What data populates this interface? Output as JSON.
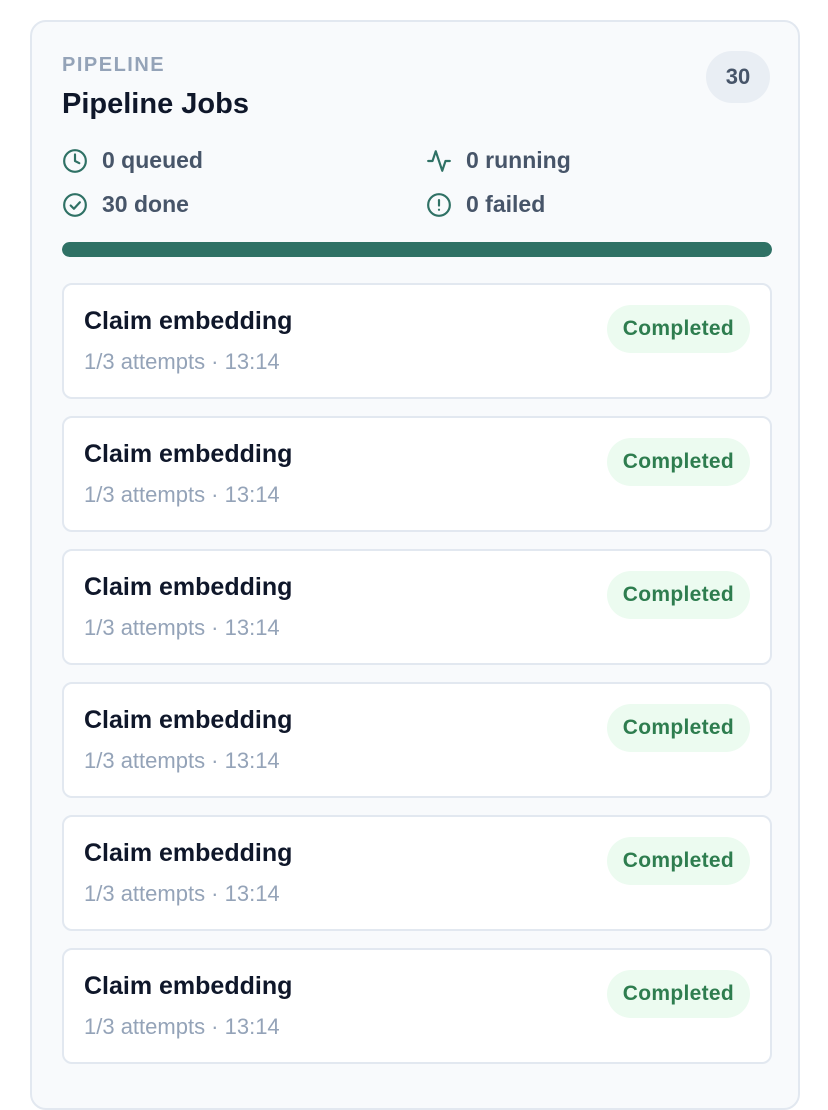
{
  "header": {
    "eyebrow": "PIPELINE",
    "title": "Pipeline Jobs",
    "total_count": "30"
  },
  "stats": {
    "queued": {
      "label": "0 queued",
      "icon": "clock-icon"
    },
    "running": {
      "label": "0 running",
      "icon": "activity-icon"
    },
    "done": {
      "label": "30 done",
      "icon": "check-circle-icon"
    },
    "failed": {
      "label": "0 failed",
      "icon": "alert-circle-icon"
    }
  },
  "progress": {
    "completed_fraction": 1.0
  },
  "jobs": [
    {
      "title": "Claim embedding",
      "meta": "1/3 attempts · 13:14",
      "status": "Completed"
    },
    {
      "title": "Claim embedding",
      "meta": "1/3 attempts · 13:14",
      "status": "Completed"
    },
    {
      "title": "Claim embedding",
      "meta": "1/3 attempts · 13:14",
      "status": "Completed"
    },
    {
      "title": "Claim embedding",
      "meta": "1/3 attempts · 13:14",
      "status": "Completed"
    },
    {
      "title": "Claim embedding",
      "meta": "1/3 attempts · 13:14",
      "status": "Completed"
    },
    {
      "title": "Claim embedding",
      "meta": "1/3 attempts · 13:14",
      "status": "Completed"
    }
  ],
  "colors": {
    "accent": "#2f7165",
    "status_completed_text": "#2e7d4f",
    "status_completed_bg": "#ecfbf0"
  }
}
